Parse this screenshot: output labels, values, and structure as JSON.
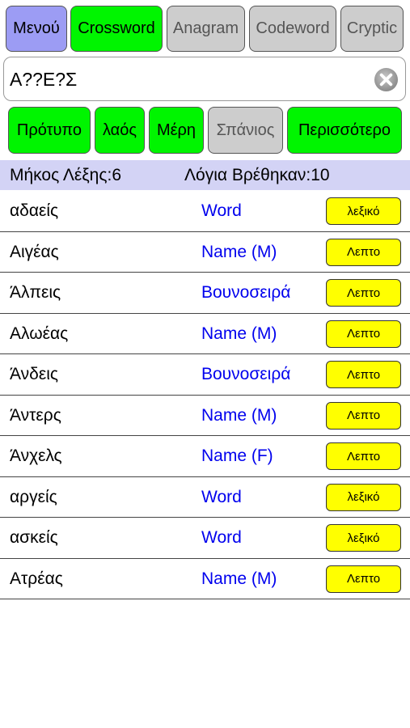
{
  "modes": [
    {
      "label": "Μενού",
      "state": "menu"
    },
    {
      "label": "Crossword",
      "state": "on"
    },
    {
      "label": "Anagram",
      "state": "off"
    },
    {
      "label": "Codeword",
      "state": "off"
    },
    {
      "label": "Cryptic",
      "state": "off"
    }
  ],
  "search": {
    "value": "Α??Ε?Σ",
    "clear_icon": "clear-icon"
  },
  "filters": [
    {
      "label": "Πρότυπο",
      "state": "on"
    },
    {
      "label": "λαός",
      "state": "on"
    },
    {
      "label": "Μέρη",
      "state": "on"
    },
    {
      "label": "Σπάνιος",
      "state": "off"
    },
    {
      "label": "Περισσότερο",
      "state": "on"
    }
  ],
  "info": {
    "length_text": "Μήκος Λέξης:6",
    "found_text": "Λόγια Βρέθηκαν:10"
  },
  "results": [
    {
      "word": "αδαείς",
      "type": "Word",
      "action": "λεξικό"
    },
    {
      "word": "Αιγέας",
      "type": "Name (M)",
      "action": "Λεπτο"
    },
    {
      "word": "Άλπεις",
      "type": "Βουνοσειρά",
      "action": "Λεπτο"
    },
    {
      "word": "Αλωέας",
      "type": "Name (M)",
      "action": "Λεπτο"
    },
    {
      "word": "Άνδεις",
      "type": "Βουνοσειρά",
      "action": "Λεπτο"
    },
    {
      "word": "Άντερς",
      "type": "Name (M)",
      "action": "Λεπτο"
    },
    {
      "word": "Άνχελς",
      "type": "Name (F)",
      "action": "Λεπτο"
    },
    {
      "word": "αργείς",
      "type": "Word",
      "action": "λεξικό"
    },
    {
      "word": "ασκείς",
      "type": "Word",
      "action": "λεξικό"
    },
    {
      "word": "Ατρέας",
      "type": "Name (M)",
      "action": "Λεπτο"
    }
  ],
  "colors": {
    "menu": "#9c9cf4",
    "active": "#00f500",
    "inactive": "#cdcdcd",
    "info_bar": "#d3d3f5",
    "type_text": "#0000ee",
    "action_button": "#ffff00"
  }
}
